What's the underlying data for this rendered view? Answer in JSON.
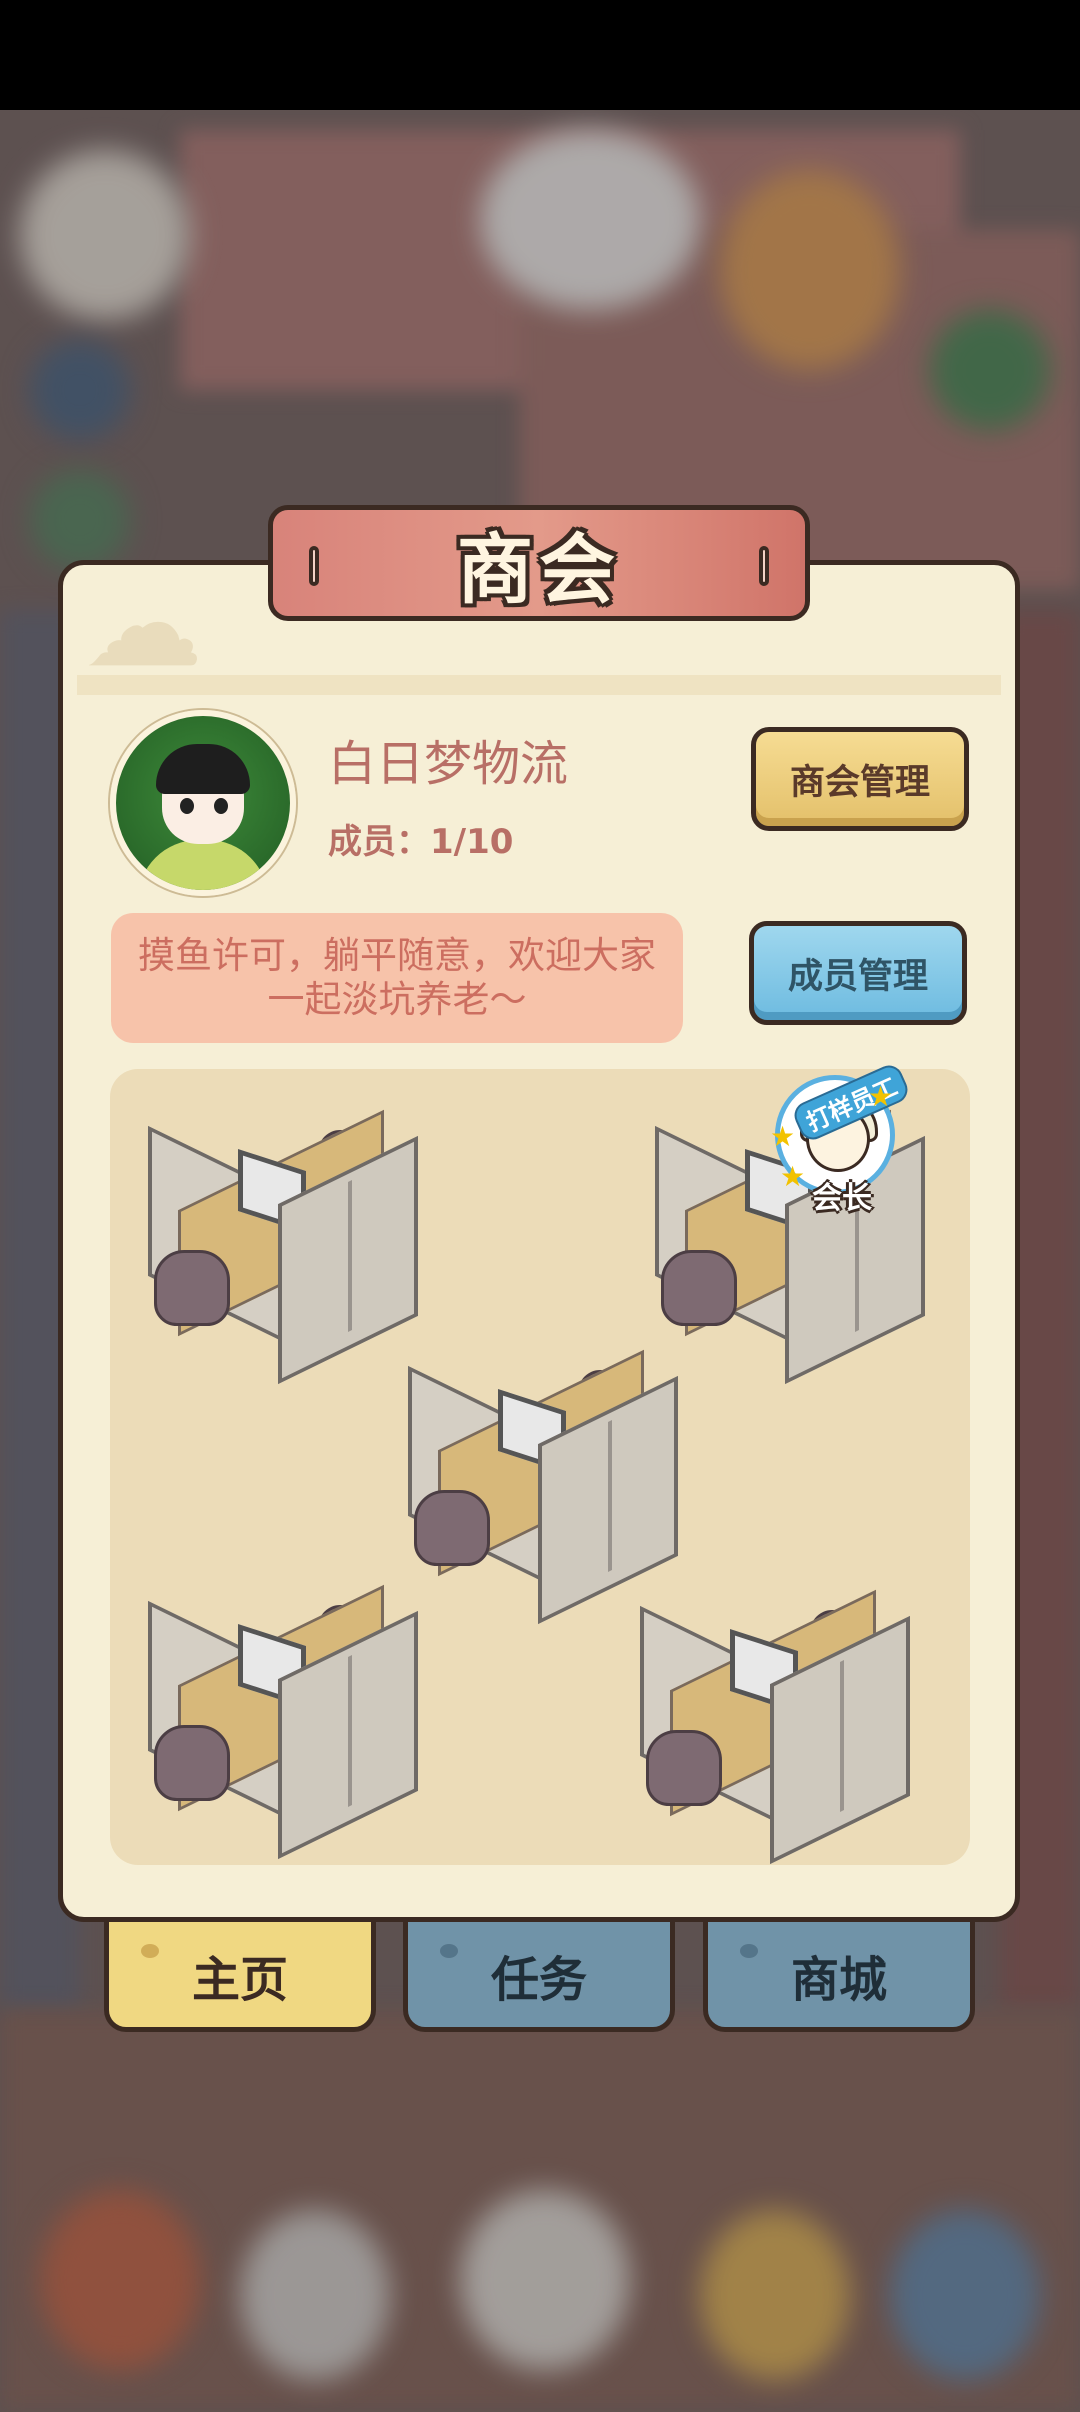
{
  "dialog": {
    "title": "商会"
  },
  "guild": {
    "name": "白日梦物流",
    "members_label": "成员：",
    "members_value": "1/10",
    "motto": "摸鱼许可，躺平随意，欢迎大家一起淡坑养老～"
  },
  "buttons": {
    "guild_manage": "商会管理",
    "member_manage": "成员管理"
  },
  "office": {
    "leader_tag": "会长",
    "leader_ribbon": "打样员工"
  },
  "tabs": [
    {
      "label": "主页",
      "active": true
    },
    {
      "label": "任务",
      "active": false
    },
    {
      "label": "商城",
      "active": false
    }
  ],
  "colors": {
    "dialog_bg": "#f6efd6",
    "title_plaque": "#e39a8a",
    "text_accent": "#b86f66",
    "guild_button": "#f6dc93",
    "member_button": "#9fd7ee",
    "active_tab": "#f0d882",
    "inactive_tab": "#7093a8"
  }
}
